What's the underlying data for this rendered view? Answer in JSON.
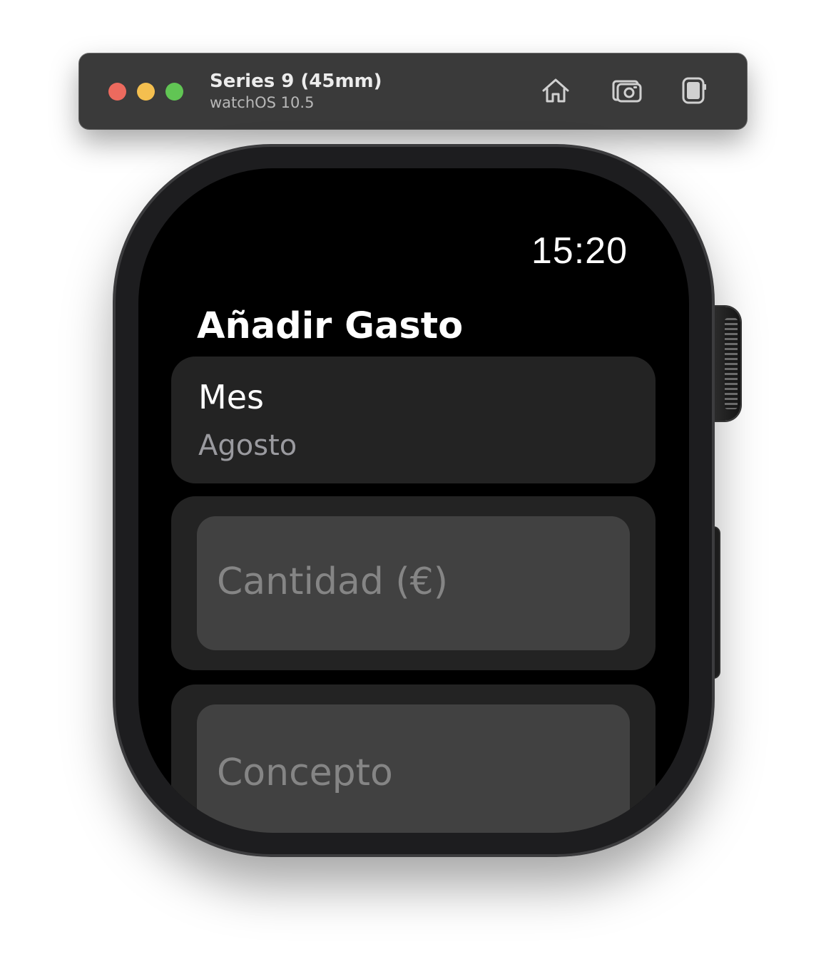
{
  "simulator": {
    "device_name": "Series 9 (45mm)",
    "os_version": "watchOS 10.5",
    "buttons": {
      "home_icon": "home-icon",
      "screenshot_icon": "camera-icon",
      "rotate_icon": "device-rotate-icon"
    }
  },
  "watch": {
    "status_time": "15:20",
    "nav_title": "Añadir Gasto",
    "month_picker": {
      "label": "Mes",
      "value": "Agosto"
    },
    "amount_field": {
      "placeholder": "Cantidad (€)",
      "value": ""
    },
    "concept_field": {
      "placeholder": "Concepto",
      "value": ""
    }
  },
  "colors": {
    "traffic_red": "#ec6a5e",
    "traffic_yellow": "#f4bf4f",
    "traffic_green": "#61c554",
    "row_background": "#232323",
    "field_background": "#414141",
    "secondary_text": "#9a9a9f"
  }
}
